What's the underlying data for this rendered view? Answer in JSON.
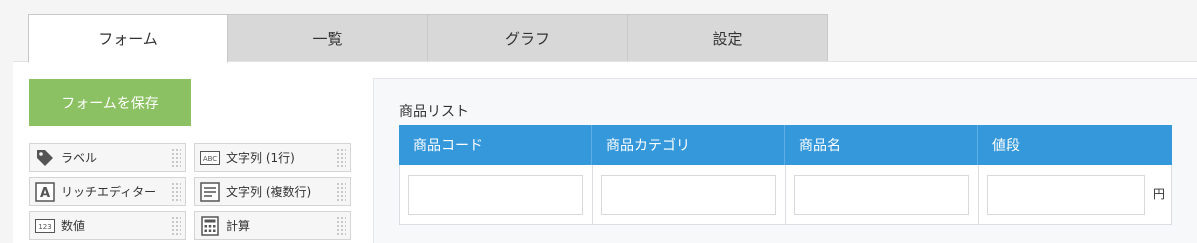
{
  "tabs": [
    "フォーム",
    "一覧",
    "グラフ",
    "設定"
  ],
  "save_button": "フォームを保存",
  "palette": [
    {
      "label": "ラベル",
      "icon": "tag-icon"
    },
    {
      "label": "文字列 (1行)",
      "icon": "abc-icon"
    },
    {
      "label": "リッチエディター",
      "icon": "rich-text-icon"
    },
    {
      "label": "文字列 (複数行)",
      "icon": "multiline-text-icon"
    },
    {
      "label": "数値",
      "icon": "number-icon"
    },
    {
      "label": "計算",
      "icon": "calculator-icon"
    }
  ],
  "icon_text": {
    "abc": "ABC",
    "rich": "A",
    "number": "123"
  },
  "table": {
    "title": "商品リスト",
    "headers": [
      "商品コード",
      "商品カテゴリ",
      "商品名",
      "値段"
    ],
    "unit": "円"
  },
  "colors": {
    "accent": "#3498db",
    "save": "#8bc163"
  }
}
